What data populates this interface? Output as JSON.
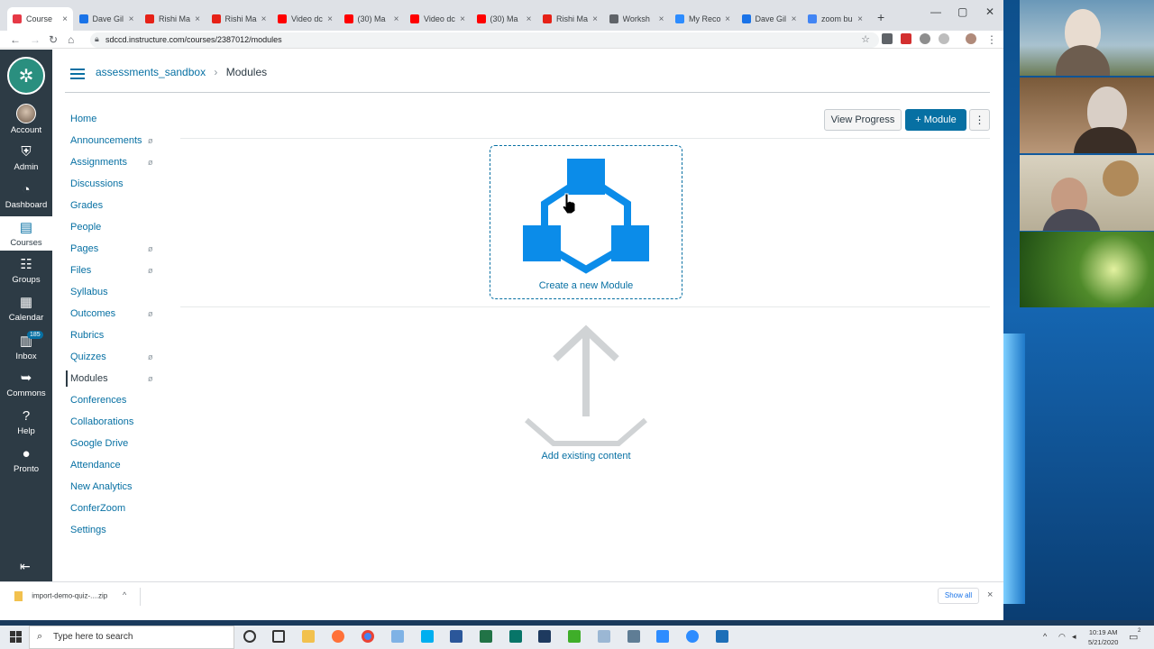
{
  "browser": {
    "tabs": [
      {
        "label": "Course",
        "favicon_color": "#e63946",
        "active": true
      },
      {
        "label": "Dave Gil",
        "favicon_color": "#1a73e8"
      },
      {
        "label": "Rishi Ma",
        "favicon_color": "#e62117"
      },
      {
        "label": "Rishi Ma",
        "favicon_color": "#e62117"
      },
      {
        "label": "Video dc",
        "favicon_color": "#ff0000"
      },
      {
        "label": "(30) Ma",
        "favicon_color": "#ff0000"
      },
      {
        "label": "Video dc",
        "favicon_color": "#ff0000"
      },
      {
        "label": "(30) Ma",
        "favicon_color": "#ff0000"
      },
      {
        "label": "Rishi Ma",
        "favicon_color": "#e62117"
      },
      {
        "label": "Worksh",
        "favicon_color": "#5f6368"
      },
      {
        "label": "My Reco",
        "favicon_color": "#2d8cff"
      },
      {
        "label": "Dave Gil",
        "favicon_color": "#1a73e8"
      },
      {
        "label": "zoom bu",
        "favicon_color": "#4285f4"
      }
    ],
    "tab_close": "×",
    "new_tab": "+",
    "url": "sdccd.instructure.com/courses/2387012/modules"
  },
  "global_nav": {
    "logo_glyph": "✲",
    "items": [
      {
        "label": "Account",
        "icon": "avatar"
      },
      {
        "label": "Admin",
        "icon": "admin-shield-icon",
        "glyph": "⛨"
      },
      {
        "label": "Dashboard",
        "icon": "dashboard-icon",
        "glyph": "◔"
      },
      {
        "label": "Courses",
        "icon": "courses-book-icon",
        "glyph": "▤",
        "active": true
      },
      {
        "label": "Groups",
        "icon": "groups-people-icon",
        "glyph": "☷"
      },
      {
        "label": "Calendar",
        "icon": "calendar-icon",
        "glyph": "▦"
      },
      {
        "label": "Inbox",
        "icon": "inbox-icon",
        "glyph": "▥",
        "badge": "185"
      },
      {
        "label": "Commons",
        "icon": "commons-arrow-icon",
        "glyph": "➥"
      },
      {
        "label": "Help",
        "icon": "help-question-icon",
        "glyph": "?"
      },
      {
        "label": "Pronto",
        "icon": "pronto-chat-icon",
        "glyph": "●"
      }
    ],
    "collapse_glyph": "⇤"
  },
  "breadcrumb": {
    "course": "assessments_sandbox",
    "separator": "›",
    "current": "Modules"
  },
  "course_nav": [
    {
      "label": "Home",
      "hidden": false
    },
    {
      "label": "Announcements",
      "hidden": true
    },
    {
      "label": "Assignments",
      "hidden": true
    },
    {
      "label": "Discussions",
      "hidden": false
    },
    {
      "label": "Grades",
      "hidden": false
    },
    {
      "label": "People",
      "hidden": false
    },
    {
      "label": "Pages",
      "hidden": true
    },
    {
      "label": "Files",
      "hidden": true
    },
    {
      "label": "Syllabus",
      "hidden": false
    },
    {
      "label": "Outcomes",
      "hidden": true
    },
    {
      "label": "Rubrics",
      "hidden": false
    },
    {
      "label": "Quizzes",
      "hidden": true
    },
    {
      "label": "Modules",
      "hidden": true,
      "active": true
    },
    {
      "label": "Conferences",
      "hidden": false
    },
    {
      "label": "Collaborations",
      "hidden": false
    },
    {
      "label": "Google Drive",
      "hidden": false
    },
    {
      "label": "Attendance",
      "hidden": false
    },
    {
      "label": "New Analytics",
      "hidden": false
    },
    {
      "label": "ConferZoom",
      "hidden": false
    },
    {
      "label": "Settings",
      "hidden": false
    }
  ],
  "course_nav_hidden_glyph": "ø",
  "actions": {
    "view_progress": "View Progress",
    "add_module": "+ Module",
    "more": "⋮"
  },
  "empty_state": {
    "create_label": "Create a new Module",
    "add_label": "Add existing content"
  },
  "download_bar": {
    "file_name": "import-demo-quiz-....zip",
    "chevron": "^",
    "show_all": "Show all",
    "close": "×"
  },
  "taskbar": {
    "search_placeholder": "Type here to search",
    "search_glyph": "⌕",
    "tray_up": "^",
    "time": "10:19 AM",
    "date": "5/21/2020",
    "notification_count": "2"
  },
  "colors": {
    "canvas_blue": "#0770a3",
    "global_nav_bg": "#2d3b45",
    "module_icon_blue": "#0b8ce9",
    "placeholder_grey": "#d0d3d5"
  }
}
